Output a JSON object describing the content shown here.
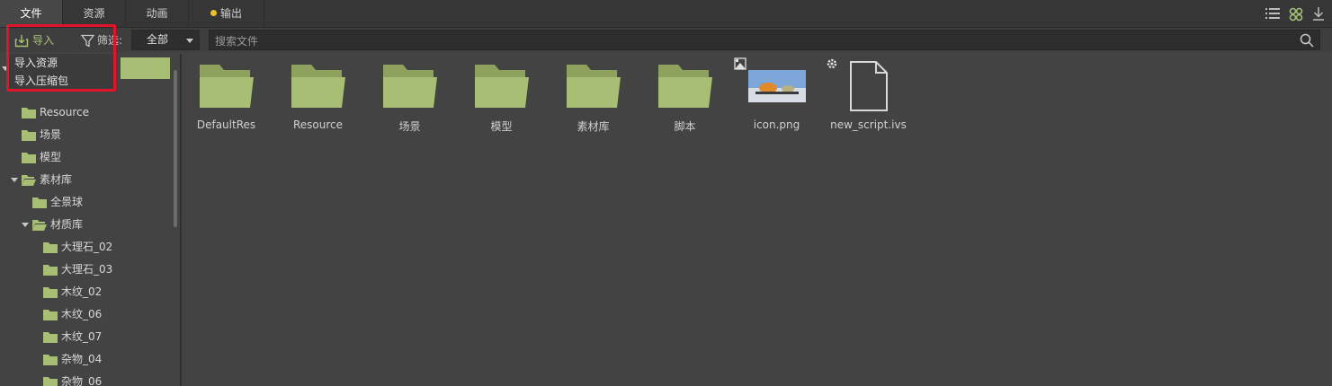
{
  "tabs": [
    {
      "label": "文件",
      "active": true
    },
    {
      "label": "资源",
      "active": false
    },
    {
      "label": "动画",
      "active": false
    },
    {
      "label": "输出",
      "active": false,
      "has_dot": true
    }
  ],
  "toolbar": {
    "import_label": "导入",
    "filter_label": "筛选:",
    "filter_value": "全部",
    "search_placeholder": "搜索文件"
  },
  "import_menu": {
    "items": [
      "导入资源",
      "导入压缩包"
    ]
  },
  "tree": {
    "items": [
      {
        "label": "Resource",
        "depth": 0,
        "expanded": false
      },
      {
        "label": "场景",
        "depth": 0,
        "expanded": false
      },
      {
        "label": "模型",
        "depth": 0,
        "expanded": false
      },
      {
        "label": "素材库",
        "depth": 0,
        "expanded": true
      },
      {
        "label": "全景球",
        "depth": 1,
        "expanded": false
      },
      {
        "label": "材质库",
        "depth": 1,
        "expanded": true
      },
      {
        "label": "大理石_02",
        "depth": 2,
        "expanded": false
      },
      {
        "label": "大理石_03",
        "depth": 2,
        "expanded": false
      },
      {
        "label": "木纹_02",
        "depth": 2,
        "expanded": false
      },
      {
        "label": "木纹_06",
        "depth": 2,
        "expanded": false
      },
      {
        "label": "木纹_07",
        "depth": 2,
        "expanded": false
      },
      {
        "label": "杂物_04",
        "depth": 2,
        "expanded": false
      },
      {
        "label": "杂物_06",
        "depth": 2,
        "expanded": false
      }
    ]
  },
  "assets": [
    {
      "label": "DefaultRes",
      "type": "folder"
    },
    {
      "label": "Resource",
      "type": "folder"
    },
    {
      "label": "场景",
      "type": "folder"
    },
    {
      "label": "模型",
      "type": "folder"
    },
    {
      "label": "素材库",
      "type": "folder"
    },
    {
      "label": "脚本",
      "type": "folder"
    },
    {
      "label": "icon.png",
      "type": "image"
    },
    {
      "label": "new_script.ivs",
      "type": "script"
    }
  ],
  "colors": {
    "folder": "#a8be74",
    "accent_green": "#a9c274",
    "highlight_red": "#e0142a",
    "dot_yellow": "#e8c22c"
  }
}
